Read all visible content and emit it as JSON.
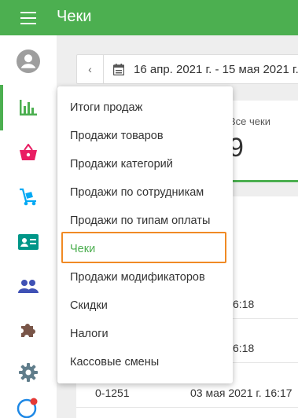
{
  "header": {
    "title": "Чеки",
    "menu_icon": "menu-icon"
  },
  "sidebar": {
    "items": [
      {
        "name": "account",
        "icon": "account-circle-icon",
        "color": "#9e9e9e"
      },
      {
        "name": "reports",
        "icon": "bar-chart-icon",
        "color": "#4caf50",
        "active": true
      },
      {
        "name": "products",
        "icon": "basket-icon",
        "color": "#e91e63"
      },
      {
        "name": "inventory",
        "icon": "cart-dolly-icon",
        "color": "#03a9f4"
      },
      {
        "name": "employees",
        "icon": "id-card-icon",
        "color": "#009688"
      },
      {
        "name": "customers",
        "icon": "people-icon",
        "color": "#3f51b5"
      },
      {
        "name": "integrations",
        "icon": "puzzle-icon",
        "color": "#795548"
      },
      {
        "name": "settings",
        "icon": "gear-icon",
        "color": "#607d8b"
      },
      {
        "name": "help",
        "icon": "help-icon",
        "color": "#1e88e5"
      }
    ]
  },
  "date_filter": {
    "range": "16 апр. 2021 г. - 15 мая 2021 г."
  },
  "summary": {
    "label": "Все чеки",
    "value": "9"
  },
  "receipts": [
    {
      "number": "",
      "datetime": "2021 г. 16:18"
    },
    {
      "number": "",
      "datetime": "2021 г. 16:18"
    },
    {
      "number": "0-1251",
      "datetime": "03 мая 2021 г. 16:17"
    }
  ],
  "report_menu": {
    "items": [
      "Итоги продаж",
      "Продажи товаров",
      "Продажи категорий",
      "Продажи по сотрудникам",
      "Продажи по типам оплаты",
      "Чеки",
      "Продажи модификаторов",
      "Скидки",
      "Налоги",
      "Кассовые смены"
    ],
    "selected_index": 5
  },
  "colors": {
    "primary": "#4caf50",
    "highlight": "#f08a24"
  }
}
